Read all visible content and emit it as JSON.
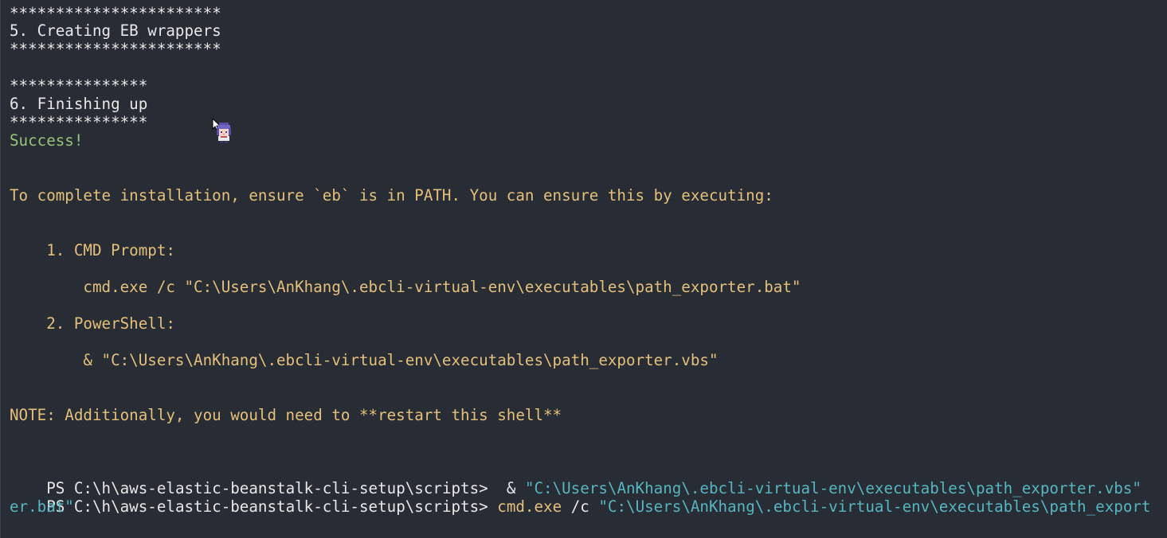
{
  "colors": {
    "background": "#282c34",
    "text": "#e8e8e8",
    "success": "#98c379",
    "info": "#e5c07b",
    "string": "#56b6c2"
  },
  "icons": {
    "cursor": "mouse-pointer-icon",
    "mascot": "pixel-character-icon"
  },
  "lines": {
    "l1": "***********************",
    "l2": "5. Creating EB wrappers",
    "l3": "***********************",
    "l4": "***************",
    "l5": "6. Finishing up",
    "l6": "***************",
    "l7": "Success!",
    "l8": "To complete installation, ensure `eb` is in PATH. You can ensure this by executing:",
    "l9": "    1. CMD Prompt:",
    "l10": "        cmd.exe /c \"C:\\Users\\AnKhang\\.ebcli-virtual-env\\executables\\path_exporter.bat\"",
    "l11": "    2. PowerShell:",
    "l12": "        & \"C:\\Users\\AnKhang\\.ebcli-virtual-env\\executables\\path_exporter.vbs\"",
    "l13": "NOTE: Additionally, you would need to **restart this shell**"
  },
  "prompt1": {
    "prompt": "PS C:\\h\\aws-elastic-beanstalk-cli-setup\\scripts> ",
    "op": " & ",
    "arg": "\"C:\\Users\\AnKhang\\.ebcli-virtual-env\\executables\\path_exporter.vbs\""
  },
  "prompt2": {
    "prompt": "PS C:\\h\\aws-elastic-beanstalk-cli-setup\\scripts> ",
    "cmd": "cmd.exe",
    "flag": " /c ",
    "arg": "\"C:\\Users\\AnKhang\\.ebcli-virtual-env\\executables\\path_export",
    "wrap": "er.bat\""
  }
}
